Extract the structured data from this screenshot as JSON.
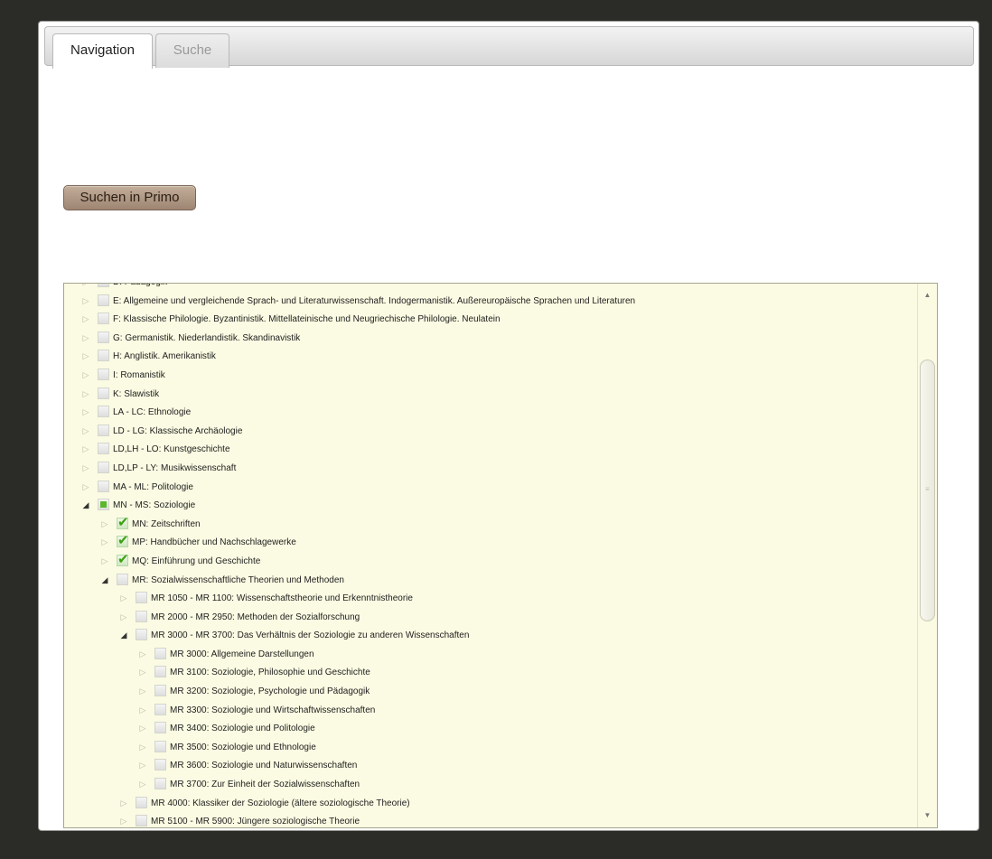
{
  "tabs": [
    {
      "label": "Navigation",
      "active": true
    },
    {
      "label": "Suche",
      "active": false
    }
  ],
  "primo_button": {
    "label": "Suchen in Primo"
  },
  "tree": [
    {
      "label": "D: Pädagogik",
      "level": 0,
      "state": "unchecked",
      "expanded": false
    },
    {
      "label": "E: Allgemeine und vergleichende Sprach- und Literaturwissenschaft. Indogermanistik. Außereuropäische Sprachen und Literaturen",
      "level": 0,
      "state": "unchecked",
      "expanded": false
    },
    {
      "label": "F: Klassische Philologie. Byzantinistik. Mittellateinische und Neugriechische Philologie. Neulatein",
      "level": 0,
      "state": "unchecked",
      "expanded": false
    },
    {
      "label": "G: Germanistik. Niederlandistik. Skandinavistik",
      "level": 0,
      "state": "unchecked",
      "expanded": false
    },
    {
      "label": "H: Anglistik. Amerikanistik",
      "level": 0,
      "state": "unchecked",
      "expanded": false
    },
    {
      "label": "I: Romanistik",
      "level": 0,
      "state": "unchecked",
      "expanded": false
    },
    {
      "label": "K: Slawistik",
      "level": 0,
      "state": "unchecked",
      "expanded": false
    },
    {
      "label": "LA - LC: Ethnologie",
      "level": 0,
      "state": "unchecked",
      "expanded": false
    },
    {
      "label": "LD - LG: Klassische Archäologie",
      "level": 0,
      "state": "unchecked",
      "expanded": false
    },
    {
      "label": "LD,LH - LO: Kunstgeschichte",
      "level": 0,
      "state": "unchecked",
      "expanded": false
    },
    {
      "label": "LD,LP - LY: Musikwissenschaft",
      "level": 0,
      "state": "unchecked",
      "expanded": false
    },
    {
      "label": "MA - ML: Politologie",
      "level": 0,
      "state": "unchecked",
      "expanded": false
    },
    {
      "label": "MN - MS: Soziologie",
      "level": 0,
      "state": "partial",
      "expanded": true
    },
    {
      "label": "MN: Zeitschriften",
      "level": 1,
      "state": "checked",
      "expanded": false
    },
    {
      "label": "MP: Handbücher und Nachschlagewerke",
      "level": 1,
      "state": "checked",
      "expanded": false
    },
    {
      "label": "MQ: Einführung und Geschichte",
      "level": 1,
      "state": "checked",
      "expanded": false
    },
    {
      "label": "MR: Sozialwissenschaftliche Theorien und Methoden",
      "level": 1,
      "state": "unchecked",
      "expanded": true
    },
    {
      "label": "MR 1050 - MR 1100: Wissenschaftstheorie und Erkenntnistheorie",
      "level": 2,
      "state": "unchecked",
      "expanded": false
    },
    {
      "label": "MR 2000 - MR 2950: Methoden der Sozialforschung",
      "level": 2,
      "state": "unchecked",
      "expanded": false
    },
    {
      "label": "MR 3000 - MR 3700: Das Verhältnis der Soziologie zu anderen Wissenschaften",
      "level": 2,
      "state": "unchecked",
      "expanded": true
    },
    {
      "label": "MR 3000: Allgemeine Darstellungen",
      "level": 3,
      "state": "unchecked",
      "expanded": false
    },
    {
      "label": "MR 3100: Soziologie, Philosophie und Geschichte",
      "level": 3,
      "state": "unchecked",
      "expanded": false
    },
    {
      "label": "MR 3200: Soziologie, Psychologie und Pädagogik",
      "level": 3,
      "state": "unchecked",
      "expanded": false
    },
    {
      "label": "MR 3300: Soziologie und Wirtschaftwissenschaften",
      "level": 3,
      "state": "unchecked",
      "expanded": false
    },
    {
      "label": "MR 3400: Soziologie und Politologie",
      "level": 3,
      "state": "unchecked",
      "expanded": false
    },
    {
      "label": "MR 3500: Soziologie und Ethnologie",
      "level": 3,
      "state": "unchecked",
      "expanded": false
    },
    {
      "label": "MR 3600: Soziologie und Naturwissenschaften",
      "level": 3,
      "state": "unchecked",
      "expanded": false
    },
    {
      "label": "MR 3700: Zur Einheit der Sozialwissenschaften",
      "level": 3,
      "state": "unchecked",
      "expanded": false
    },
    {
      "label": "MR 4000: Klassiker der Soziologie (ältere soziologische Theorie)",
      "level": 2,
      "state": "unchecked",
      "expanded": false
    },
    {
      "label": "MR 5100 - MR 5900: Jüngere soziologische Theorie",
      "level": 2,
      "state": "unchecked",
      "expanded": false
    }
  ],
  "scrollbar": {
    "up_icon": "▲",
    "down_icon": "▼",
    "grip_icon": "≡"
  },
  "colors": {
    "page_bg": "#2b2c27",
    "tree_bg": "#fbfbe3",
    "button_bg": "#b09a86",
    "check_green": "#3da012"
  }
}
